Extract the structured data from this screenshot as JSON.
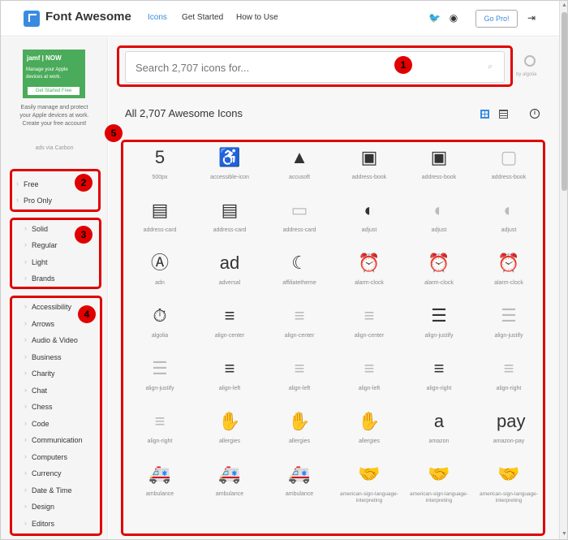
{
  "header": {
    "brand": "Font Awesome",
    "nav": [
      "Icons",
      "Get Started",
      "How to Use"
    ],
    "go_pro": "Go Pro!",
    "icons": [
      "twitter-icon",
      "github-icon",
      "sign-in-icon"
    ]
  },
  "ad": {
    "brand": "jamf | NOW",
    "headline_1": "Manage your Apple",
    "headline_2": "devices at work.",
    "cta": "Get Started Free",
    "body": "Easily manage and protect your Apple devices at work. Create your free account!",
    "via": "ads via Carbon"
  },
  "filters": {
    "license": [
      "Free",
      "Pro Only"
    ],
    "style": [
      "Solid",
      "Regular",
      "Light",
      "Brands"
    ],
    "categories": [
      "Accessibility",
      "Arrows",
      "Audio & Video",
      "Business",
      "Charity",
      "Chat",
      "Chess",
      "Code",
      "Communication",
      "Computers",
      "Currency",
      "Date & Time",
      "Design",
      "Editors"
    ]
  },
  "search": {
    "placeholder": "Search 2,707 icons for...",
    "by": "by algolia"
  },
  "results": {
    "title": "All 2,707 Awesome Icons"
  },
  "icons": [
    {
      "name": "500px",
      "glyph": "5",
      "style": "dark"
    },
    {
      "name": "accessible-icon",
      "glyph": "♿",
      "style": "dark"
    },
    {
      "name": "accusoft",
      "glyph": "▲",
      "style": "dark"
    },
    {
      "name": "address-book",
      "glyph": "▣",
      "style": "dark"
    },
    {
      "name": "address-book",
      "glyph": "▣",
      "style": "dark"
    },
    {
      "name": "address-book",
      "glyph": "▢",
      "style": "light"
    },
    {
      "name": "address-card",
      "glyph": "▤",
      "style": "dark"
    },
    {
      "name": "address-card",
      "glyph": "▤",
      "style": "dark"
    },
    {
      "name": "address-card",
      "glyph": "▭",
      "style": "light"
    },
    {
      "name": "adjust",
      "glyph": "◐",
      "style": "dark"
    },
    {
      "name": "adjust",
      "glyph": "◐",
      "style": "light"
    },
    {
      "name": "adjust",
      "glyph": "◐",
      "style": "light"
    },
    {
      "name": "adn",
      "glyph": "Ⓐ",
      "style": "dark"
    },
    {
      "name": "adversal",
      "glyph": "ad",
      "style": "dark"
    },
    {
      "name": "affiliatetheme",
      "glyph": "☾",
      "style": "dark"
    },
    {
      "name": "alarm-clock",
      "glyph": "⏰",
      "style": "light"
    },
    {
      "name": "alarm-clock",
      "glyph": "⏰",
      "style": "light"
    },
    {
      "name": "alarm-clock",
      "glyph": "⏰",
      "style": "light"
    },
    {
      "name": "algolia",
      "glyph": "⏱",
      "style": "dark"
    },
    {
      "name": "align-center",
      "glyph": "≡",
      "style": "dark"
    },
    {
      "name": "align-center",
      "glyph": "≡",
      "style": "light"
    },
    {
      "name": "align-center",
      "glyph": "≡",
      "style": "light"
    },
    {
      "name": "align-justify",
      "glyph": "☰",
      "style": "dark"
    },
    {
      "name": "align-justify",
      "glyph": "☰",
      "style": "light"
    },
    {
      "name": "align-justify",
      "glyph": "☰",
      "style": "light"
    },
    {
      "name": "align-left",
      "glyph": "≡",
      "style": "dark"
    },
    {
      "name": "align-left",
      "glyph": "≡",
      "style": "light"
    },
    {
      "name": "align-left",
      "glyph": "≡",
      "style": "light"
    },
    {
      "name": "align-right",
      "glyph": "≡",
      "style": "dark"
    },
    {
      "name": "align-right",
      "glyph": "≡",
      "style": "light"
    },
    {
      "name": "align-right",
      "glyph": "≡",
      "style": "light"
    },
    {
      "name": "allergies",
      "glyph": "✋",
      "style": "dark"
    },
    {
      "name": "allergies",
      "glyph": "✋",
      "style": "light"
    },
    {
      "name": "allergies",
      "glyph": "✋",
      "style": "light"
    },
    {
      "name": "amazon",
      "glyph": "a",
      "style": "dark"
    },
    {
      "name": "amazon-pay",
      "glyph": "pay",
      "style": "dark"
    },
    {
      "name": "ambulance",
      "glyph": "🚑",
      "style": "dark"
    },
    {
      "name": "ambulance",
      "glyph": "🚑",
      "style": "light"
    },
    {
      "name": "ambulance",
      "glyph": "🚑",
      "style": "light"
    },
    {
      "name": "american-sign-language-interpreting",
      "glyph": "🤝",
      "style": "dark"
    },
    {
      "name": "american-sign-language-interpreting",
      "glyph": "🤝",
      "style": "light"
    },
    {
      "name": "american-sign-language-interpreting",
      "glyph": "🤝",
      "style": "light"
    }
  ],
  "annotations": [
    "1",
    "2",
    "3",
    "4",
    "5"
  ],
  "colors": {
    "accent": "#3a8be0",
    "annotation": "#e00000"
  }
}
